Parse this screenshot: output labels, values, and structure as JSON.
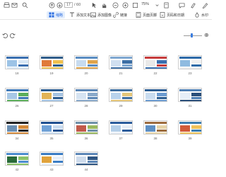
{
  "toolbar": {
    "page_current": "17",
    "page_total": "/ 60",
    "zoom": "75%"
  },
  "toolbar2": {
    "thumbnail_label": "缩略",
    "add_text_label": "添加文本",
    "add_image_label": "添加图像",
    "link_label": "链接",
    "header_footer_label": "页面页脚",
    "page_count_label": "页码和日期",
    "watermark_label": "水印"
  },
  "pages": [
    {
      "label": "18"
    },
    {
      "label": "19"
    },
    {
      "label": "20"
    },
    {
      "label": "21"
    },
    {
      "label": "22"
    },
    {
      "label": "23"
    },
    {
      "label": "26"
    },
    {
      "label": "27"
    },
    {
      "label": "28"
    },
    {
      "label": "29"
    },
    {
      "label": "30"
    },
    {
      "label": "31"
    },
    {
      "label": "34"
    },
    {
      "label": "35"
    },
    {
      "label": "36"
    },
    {
      "label": "37"
    },
    {
      "label": "38"
    },
    {
      "label": "39"
    },
    {
      "label": "42"
    },
    {
      "label": "43"
    },
    {
      "label": "44"
    }
  ],
  "colors": {
    "accent": "#2b6de0",
    "thumb_border": "#cfcfcf"
  }
}
